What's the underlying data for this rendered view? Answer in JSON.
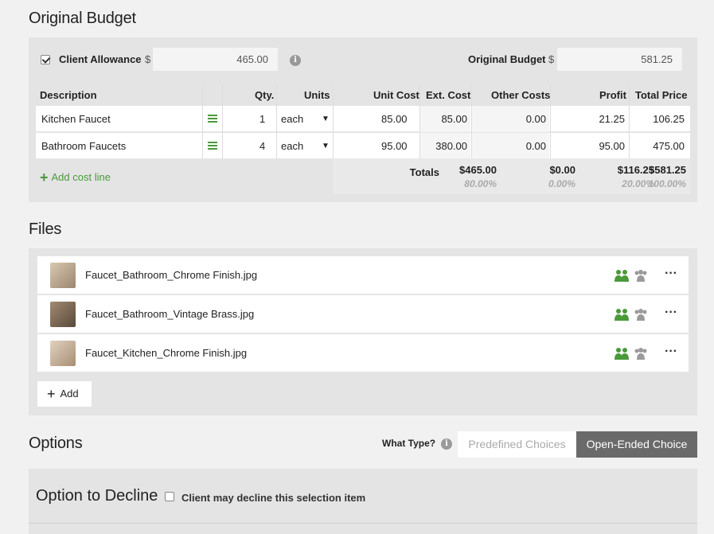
{
  "original_budget": {
    "title": "Original Budget",
    "client_allowance_label": "Client Allowance",
    "client_allowance_checked": true,
    "currency": "$",
    "client_allowance_value": "465.00",
    "original_budget_label": "Original Budget",
    "original_budget_value": "581.25",
    "columns": [
      "Description",
      "Qty.",
      "Units",
      "Unit Cost",
      "Ext. Cost",
      "Other Costs",
      "Profit",
      "Total Price"
    ],
    "rows": [
      {
        "description": "Kitchen Faucet",
        "qty": "1",
        "units": "each",
        "unit_cost": "85.00",
        "ext_cost": "85.00",
        "other_costs": "0.00",
        "profit": "21.25",
        "total_price": "106.25"
      },
      {
        "description": "Bathroom Faucets",
        "qty": "4",
        "units": "each",
        "unit_cost": "95.00",
        "ext_cost": "380.00",
        "other_costs": "0.00",
        "profit": "95.00",
        "total_price": "475.00"
      }
    ],
    "add_cost_line": "Add cost line",
    "totals_label": "Totals",
    "totals": {
      "ext_cost": "$465.00",
      "ext_cost_pct": "80.00%",
      "other_costs": "$0.00",
      "other_costs_pct": "0.00%",
      "profit": "$116.25",
      "profit_pct": "20.00%",
      "total_price": "$581.25",
      "total_price_pct": "100.00%"
    }
  },
  "files": {
    "title": "Files",
    "items": [
      {
        "name": "Faucet_Bathroom_Chrome Finish.jpg",
        "thumb_color": "#b9a590"
      },
      {
        "name": "Faucet_Bathroom_Vintage Brass.jpg",
        "thumb_color": "#8a7560"
      },
      {
        "name": "Faucet_Kitchen_Chrome Finish.jpg",
        "thumb_color": "#c8b6a2"
      }
    ],
    "add_label": "Add",
    "share_sub_color": "#4a9a3a",
    "share_owner_color": "#9a9a9a"
  },
  "options": {
    "title": "Options",
    "what_type_label": "What Type?",
    "predefined_label": "Predefined Choices",
    "open_ended_label": "Open-Ended Choice",
    "selected": "Open-Ended Choice",
    "decline_title": "Option to Decline",
    "decline_checkbox_label": "Client may decline this selection item",
    "decline_checked": false
  }
}
